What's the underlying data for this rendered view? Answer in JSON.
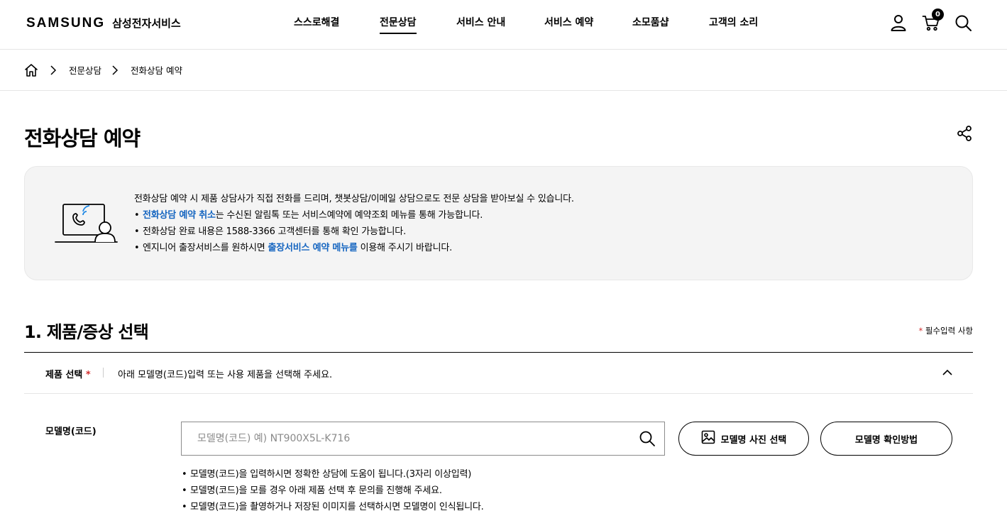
{
  "header": {
    "logo_brand": "SAMSUNG",
    "logo_service": "삼성전자서비스",
    "nav": [
      {
        "label": "스스로해결",
        "active": false
      },
      {
        "label": "전문상담",
        "active": true
      },
      {
        "label": "서비스 안내",
        "active": false
      },
      {
        "label": "서비스 예약",
        "active": false
      },
      {
        "label": "소모품샵",
        "active": false
      },
      {
        "label": "고객의 소리",
        "active": false
      }
    ],
    "cart_count": "0",
    "icons": [
      "user-icon",
      "cart-icon",
      "search-icon"
    ]
  },
  "breadcrumb": {
    "items": [
      "전문상담",
      "전화상담 예약"
    ]
  },
  "page": {
    "title": "전화상담 예약"
  },
  "info": {
    "intro": "전화상담 예약 시 제품 상담사가 직접 전화를 드리며, 챗봇상담/이메일 상담으로도 전문 상담을 받아보실 수 있습니다.",
    "bullet1_link": "전화상담 예약 취소",
    "bullet1_rest": "는 수신된 알림톡 또는 서비스예약에 예약조회 메뉴를 통해 가능합니다.",
    "bullet2": "전화상담 완료 내용은 1588-3366 고객센터를 통해 확인 가능합니다.",
    "bullet3_pre": "엔지니어 출장서비스를 원하시면 ",
    "bullet3_link": "출장서비스 예약 메뉴를",
    "bullet3_post": " 이용해 주시기 바랍니다.",
    "link_color": "#1565c0"
  },
  "section1": {
    "title": "1. 제품/증상 선택",
    "required_note": "필수입력 사항",
    "required_star": "*",
    "product_label": "제품 선택",
    "product_desc": "아래 모델명(코드)입력 또는 사용 제품을 선택해 주세요.",
    "model_label": "모델명(코드)",
    "model_placeholder": "모델명(코드) 예) NT900X5L-K716",
    "model_value": "",
    "btn_photo": "모델명 사진 선택",
    "btn_howto": "모델명 확인방법",
    "tips": [
      "모델명(코드)을 입력하시면 정확한 상담에 도움이 됩니다.(3자리 이상입력)",
      "모델명(코드)을 모를 경우 아래 제품 선택 후 문의를 진행해 주세요.",
      "모델명(코드)을 촬영하거나 저장된 이미지를 선택하시면 모델명이 인식됩니다."
    ]
  }
}
